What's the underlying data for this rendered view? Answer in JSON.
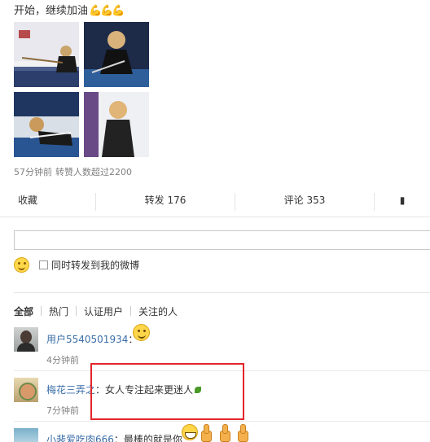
{
  "post": {
    "text": "开始，继续加油",
    "emoji_icons": [
      "flexed-biceps-icon",
      "flexed-biceps-icon",
      "flexed-biceps-icon"
    ],
    "emoji_glyphs": "💪💪💪",
    "time": "57分钟前",
    "repost_note": "转赞人数超过2200"
  },
  "actions": {
    "collect": "收藏",
    "repost": "转发 176",
    "comment": "评论 353",
    "like": "▮"
  },
  "comment_form": {
    "input_value": "",
    "emoji_icon": "smiley-icon",
    "checkbox_label": "同时转发到我的微博",
    "checkbox_checked": false
  },
  "filters": {
    "items": [
      "全部",
      "热门",
      "认证用户",
      "关注的人"
    ],
    "active": "全部"
  },
  "comments": [
    {
      "user": "用户5540501934",
      "separator": "：",
      "text": "",
      "emoji": "smiley-icon",
      "time": "4分钟前"
    },
    {
      "user": "梅花三弄之",
      "separator": "：",
      "text": "女人专注起来更迷人",
      "emoji": "leaf-icon",
      "time": "7分钟前"
    },
    {
      "user": "小裴爱吃肉666",
      "separator": "：",
      "text": "最棒的就是你",
      "emoji": "grin-icon",
      "extra_emoji": [
        "thumbs-up-icon",
        "thumbs-up-icon",
        "thumbs-up-icon"
      ]
    }
  ],
  "colors": {
    "link": "#3b6ea8",
    "highlight_box": "#e2262b",
    "meta_text": "#808080"
  }
}
